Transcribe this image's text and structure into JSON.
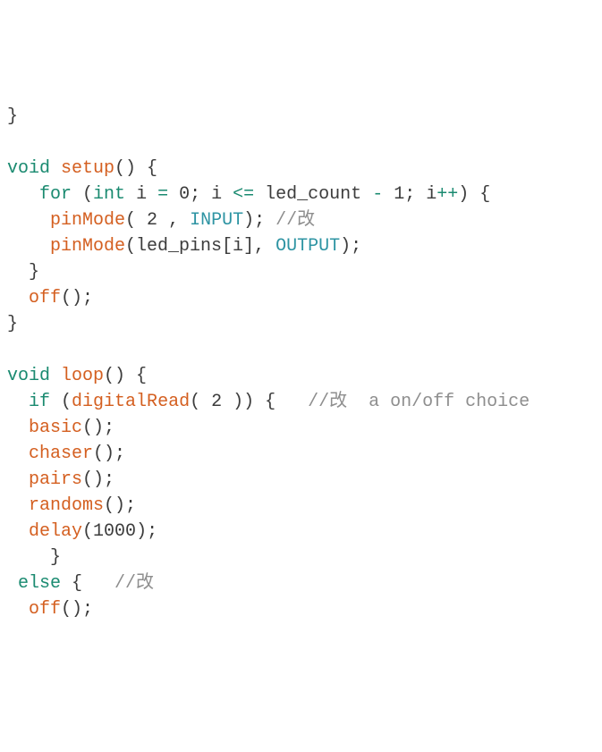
{
  "code": {
    "l0": "}",
    "l1": "",
    "l2_kw1": "void",
    "l2_sp1": " ",
    "l2_fn": "setup",
    "l2_rest": "() {",
    "l3_ind": "   ",
    "l3_kw1": "for",
    "l3_sp1": " (",
    "l3_kw2": "int",
    "l3_sp2": " i ",
    "l3_op1": "=",
    "l3_sp3": " ",
    "l3_num1": "0",
    "l3_sp4": "; i ",
    "l3_op2": "<=",
    "l3_sp5": " led_count ",
    "l3_op3": "-",
    "l3_sp6": " ",
    "l3_num2": "1",
    "l3_sp7": "; i",
    "l3_op4": "++",
    "l3_rest": ") {    ",
    "l4_ind": "    ",
    "l4_fn": "pinMode",
    "l4_args1": "( ",
    "l4_num": "2",
    "l4_args2": " , ",
    "l4_const": "INPUT",
    "l4_args3": "); ",
    "l4_cmt": "//改",
    "l5_ind": "    ",
    "l5_fn": "pinMode",
    "l5_args1": "(led_pins[i], ",
    "l5_const": "OUTPUT",
    "l5_args2": ");",
    "l6_ind": "  ",
    "l6_txt": "}",
    "l7_ind": "  ",
    "l7_fn": "off",
    "l7_rest": "();",
    "l8": "}",
    "l9": "",
    "l10_kw": "void",
    "l10_sp": " ",
    "l10_fn": "loop",
    "l10_rest": "() {",
    "l11_ind": "  ",
    "l11_kw": "if",
    "l11_sp1": " (",
    "l11_fn": "digitalRead",
    "l11_args": "( ",
    "l11_num": "2",
    "l11_args2": " )) {   ",
    "l11_cmt": "//改  a on/off choice",
    "l12_ind": "  ",
    "l12_fn": "basic",
    "l12_rest": "();",
    "l13_ind": "  ",
    "l13_fn": "chaser",
    "l13_rest": "();",
    "l14_ind": "  ",
    "l14_fn": "pairs",
    "l14_rest": "();",
    "l15_ind": "  ",
    "l15_fn": "randoms",
    "l15_rest": "();",
    "l16_ind": "  ",
    "l16_fn": "delay",
    "l16_args1": "(",
    "l16_num": "1000",
    "l16_args2": ");",
    "l17_ind": "    ",
    "l17_txt": "}",
    "l18_ind": " ",
    "l18_kw": "else",
    "l18_txt": " {   ",
    "l18_cmt": "//改",
    "l19_ind": "  ",
    "l19_fn": "off",
    "l19_rest": "();"
  }
}
